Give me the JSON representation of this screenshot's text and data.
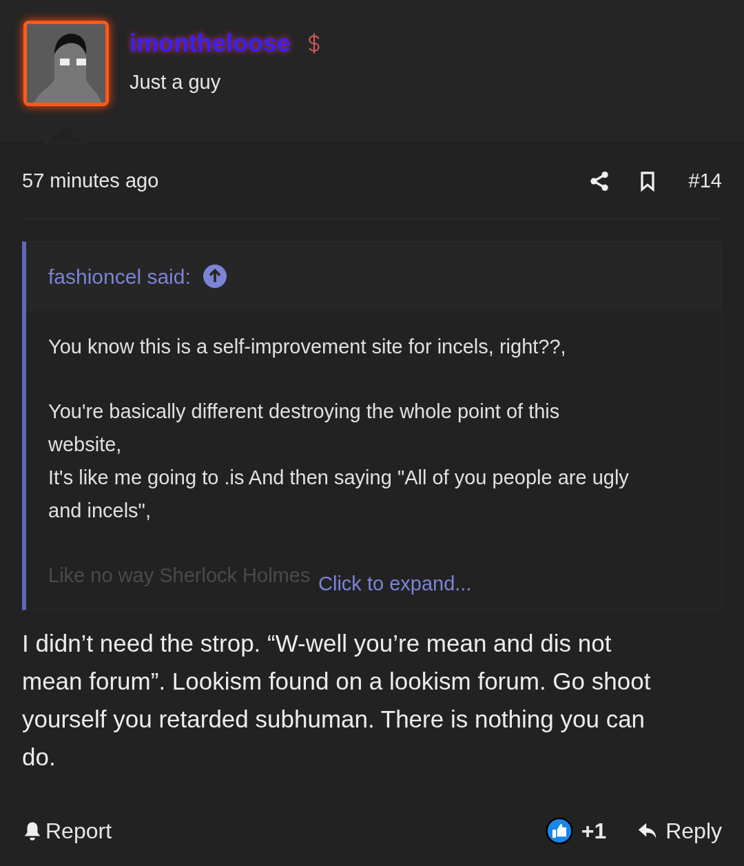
{
  "author": {
    "username": "imontheloose",
    "title": "Just a guy"
  },
  "post": {
    "time": "57 minutes ago",
    "number": "#14",
    "quote": {
      "attribution": "fashioncel said:",
      "paragraphs": [
        "You know this is a self-improvement site for incels, right??,",
        "You're basically different destroying the whole point of this website,\nIt's like me going to .is And then saying \"All of you people are ugly and incels\",",
        "Like no way Sherlock Holmes"
      ],
      "expand": "Click to expand..."
    },
    "body": "I didn’t need the strop. “W-well you’re mean and dis not mean forum”. Lookism found on a lookism forum. Go shoot yourself you retarded subhuman. There is nothing you can do.",
    "actions": {
      "report": "Report",
      "reactions": "+1",
      "reply": "Reply"
    }
  }
}
